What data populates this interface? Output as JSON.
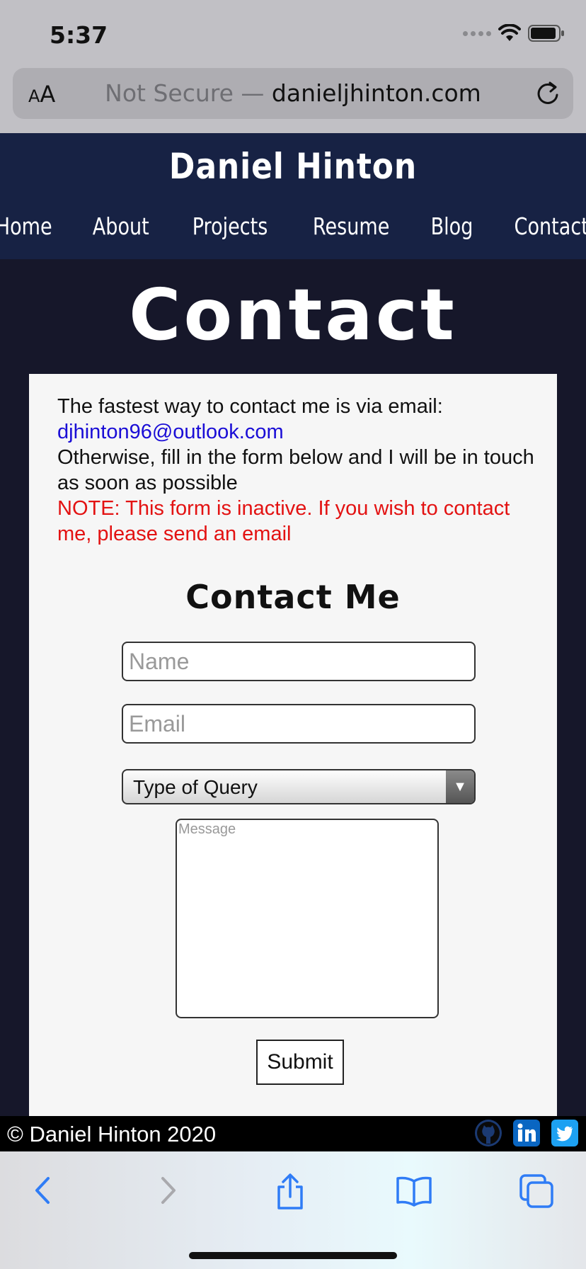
{
  "status_bar": {
    "time": "5:37"
  },
  "browser": {
    "text_size_label_small": "A",
    "text_size_label_large": "A",
    "url_prefix": "Not Secure — ",
    "url_domain": "danieljhinton.com"
  },
  "site": {
    "title": "Daniel Hinton",
    "nav": [
      "Home",
      "About",
      "Projects",
      "Resume",
      "Blog",
      "Contact"
    ]
  },
  "page": {
    "heading": "Contact",
    "intro_line1": "The fastest way to contact me is via email:",
    "email_link": "djhinton96@outlook.com",
    "intro_line2": "Otherwise, fill in the form below and I will be in touch as soon as possible",
    "note": "NOTE: This form is inactive. If you wish to contact me, please send an email"
  },
  "form": {
    "title": "Contact Me",
    "name_placeholder": "Name",
    "email_placeholder": "Email",
    "query_select_value": "Type of Query",
    "message_placeholder": "Message",
    "submit_label": "Submit"
  },
  "footer": {
    "copyright": "© Daniel Hinton 2020",
    "social_icons": [
      "github-icon",
      "linkedin-icon",
      "twitter-icon"
    ]
  },
  "toolbar_icons": [
    "back-icon",
    "forward-icon",
    "share-icon",
    "bookmarks-icon",
    "tabs-icon"
  ],
  "colors": {
    "header_bg": "#172244",
    "page_bg": "#16172a",
    "link": "#1a0dd6",
    "note": "#e31212",
    "ios_blue": "#2f7cf6"
  }
}
